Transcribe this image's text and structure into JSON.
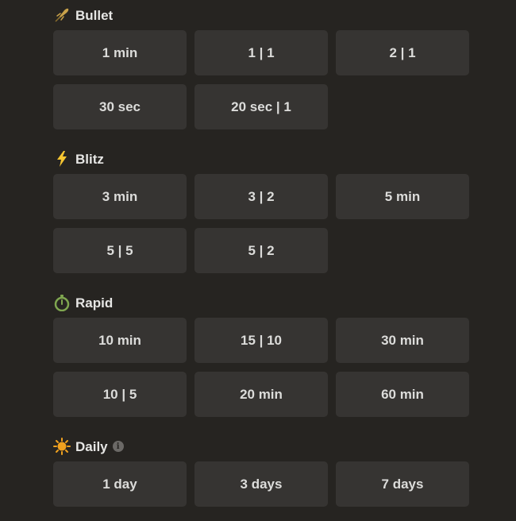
{
  "sections": [
    {
      "name": "Bullet",
      "icon": "bullet-icon",
      "buttons": [
        "1 min",
        "1 | 1",
        "2 | 1",
        "30 sec",
        "20 sec | 1"
      ]
    },
    {
      "name": "Blitz",
      "icon": "lightning-icon",
      "buttons": [
        "3 min",
        "3 | 2",
        "5 min",
        "5 | 5",
        "5 | 2"
      ]
    },
    {
      "name": "Rapid",
      "icon": "stopwatch-icon",
      "buttons": [
        "10 min",
        "15 | 10",
        "30 min",
        "10 | 5",
        "20 min",
        "60 min"
      ]
    },
    {
      "name": "Daily",
      "icon": "sun-icon",
      "info_icon": "info-icon",
      "buttons": [
        "1 day",
        "3 days",
        "7 days"
      ]
    }
  ],
  "colors": {
    "background": "#262421",
    "button": "#363432",
    "text": "#dcdcda",
    "bullet_icon": "#c9a24a",
    "blitz_icon": "#f7c631",
    "rapid_icon": "#7fa650",
    "daily_icon": "#f0a11f"
  }
}
